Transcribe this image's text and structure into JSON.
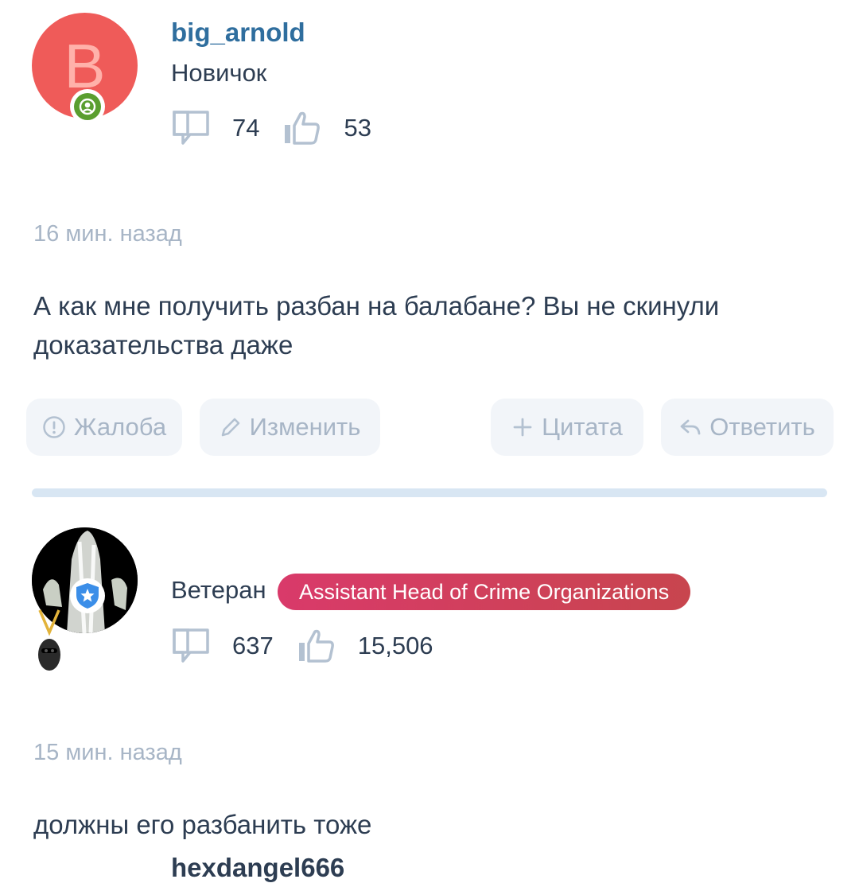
{
  "posts": [
    {
      "avatar_letter": "B",
      "username": "big_arnold",
      "rank": "Новичок",
      "messages_count": "74",
      "likes_count": "53",
      "time": "16 мин. назад",
      "text": "А как мне получить разбан на балабане? Вы не скинули доказательства даже",
      "actions": {
        "report": "Жалоба",
        "edit": "Изменить",
        "quote": "Цитата",
        "reply": "Ответить"
      }
    },
    {
      "username": "hexdangel666",
      "rank": "Ветеран",
      "role": "Assistant Head of Crime Organizations",
      "messages_count": "637",
      "likes_count": "15,506",
      "time": "15 мин. назад",
      "text": "должны его разбанить тоже"
    }
  ],
  "colors": {
    "username_default": "#2f6e9e",
    "username_highlight": "#d13a6d",
    "muted_text": "#a7b5c6",
    "button_bg": "#f2f5f9",
    "avatar_bg": "#ef5b59",
    "online_badge": "#5a9e2f",
    "role_gradient_start": "#d93a6a",
    "role_gradient_end": "#c8454e"
  }
}
